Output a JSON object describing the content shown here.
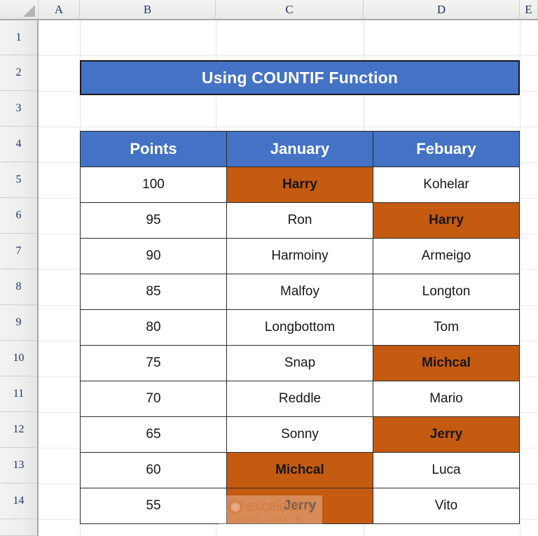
{
  "spreadsheet": {
    "column_headers": [
      "A",
      "B",
      "C",
      "D",
      "E"
    ],
    "row_headers": [
      "1",
      "2",
      "3",
      "4",
      "5",
      "6",
      "7",
      "8",
      "9",
      "10",
      "11",
      "12",
      "13",
      "14"
    ],
    "colors": {
      "header_blue": "#4472C4",
      "highlight_orange": "#C55A11",
      "cell_border": "#2b2b2b",
      "header_text": "#ffffff",
      "gridline": "#e4e4e4"
    }
  },
  "title_banner": {
    "text": "Using COUNTIF Function"
  },
  "table": {
    "headers": [
      "Points",
      "January",
      "Febuary"
    ],
    "rows": [
      {
        "points": "100",
        "january": "Harry",
        "february": "Kohelar",
        "january_highlight": true,
        "february_highlight": false
      },
      {
        "points": "95",
        "january": "Ron",
        "february": "Harry",
        "january_highlight": false,
        "february_highlight": true
      },
      {
        "points": "90",
        "january": "Harmoiny",
        "february": "Armeigo",
        "january_highlight": false,
        "february_highlight": false
      },
      {
        "points": "85",
        "january": "Malfoy",
        "february": "Longton",
        "january_highlight": false,
        "february_highlight": false
      },
      {
        "points": "80",
        "january": "Longbottom",
        "february": "Tom",
        "january_highlight": false,
        "february_highlight": false
      },
      {
        "points": "75",
        "january": "Snap",
        "february": "Michcal",
        "january_highlight": false,
        "february_highlight": true
      },
      {
        "points": "70",
        "january": "Reddle",
        "february": "Mario",
        "january_highlight": false,
        "february_highlight": false
      },
      {
        "points": "65",
        "january": "Sonny",
        "february": "Jerry",
        "january_highlight": false,
        "february_highlight": true
      },
      {
        "points": "60",
        "january": "Michcal",
        "february": "Luca",
        "january_highlight": true,
        "february_highlight": false
      },
      {
        "points": "55",
        "january": "Jerry",
        "february": "Vito",
        "january_highlight": true,
        "february_highlight": false
      }
    ]
  },
  "watermark": {
    "name": "exceldemy",
    "tagline": "EXCEL · DATA · BI",
    "logo_icon": "hexagon-cube-icon"
  }
}
